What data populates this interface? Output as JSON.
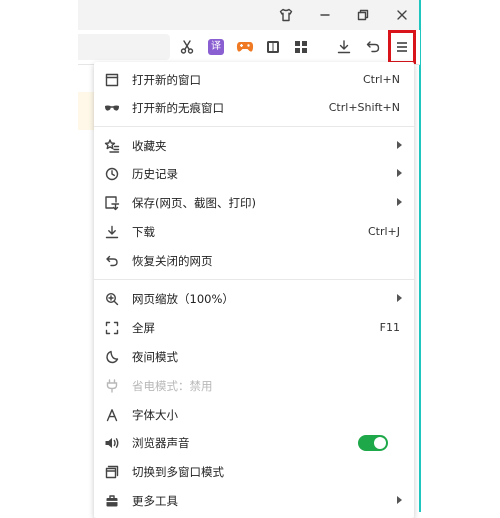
{
  "menu": {
    "items": [
      {
        "label": "打开新的窗口",
        "shortcut": "Ctrl+N",
        "icon": "window-icon"
      },
      {
        "label": "打开新的无痕窗口",
        "shortcut": "Ctrl+Shift+N",
        "icon": "incognito-icon"
      },
      {
        "label": "收藏夹",
        "icon": "star-list-icon",
        "submenu": true
      },
      {
        "label": "历史记录",
        "icon": "clock-icon",
        "submenu": true
      },
      {
        "label": "保存(网页、截图、打印)",
        "icon": "save-page-icon",
        "submenu": true
      },
      {
        "label": "下载",
        "shortcut": "Ctrl+J",
        "icon": "download-icon"
      },
      {
        "label": "恢复关闭的网页",
        "icon": "undo-icon"
      },
      {
        "label": "网页缩放（100%）",
        "icon": "zoom-icon",
        "submenu": true
      },
      {
        "label": "全屏",
        "shortcut": "F11",
        "icon": "fullscreen-icon"
      },
      {
        "label": "夜间模式",
        "icon": "moon-icon"
      },
      {
        "label": "省电模式：禁用",
        "icon": "power-plug-icon",
        "disabled": true
      },
      {
        "label": "字体大小",
        "icon": "font-icon"
      },
      {
        "label": "浏览器声音",
        "icon": "speaker-icon",
        "toggle": true
      },
      {
        "label": "切换到多窗口模式",
        "icon": "multi-window-icon"
      },
      {
        "label": "更多工具",
        "icon": "toolbox-icon",
        "submenu": true
      }
    ]
  },
  "toolbar": {
    "translate_glyph": "译"
  },
  "colors": {
    "accent_red": "#d9141b",
    "toggle_green": "#1fa84a",
    "edge_teal": "#1fc6c0"
  }
}
